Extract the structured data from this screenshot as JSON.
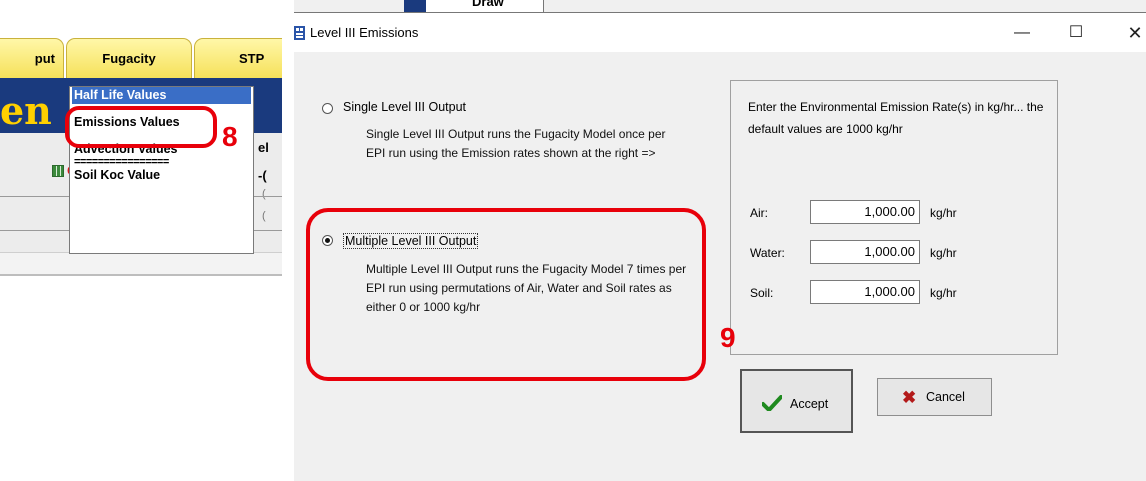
{
  "background_app": {
    "tabs": [
      "put",
      "Fugacity",
      "STP"
    ],
    "big_text": "en",
    "red_fragment": "Ca",
    "right_fragments": [
      "el",
      "-(",
      "(",
      "("
    ],
    "fugacity_menu": {
      "items": [
        "Half Life Values",
        "Emissions Values",
        "Advection Values",
        "Soil Koc Value"
      ],
      "separator": "================",
      "highlighted_index": 0
    }
  },
  "dialog": {
    "partial_tab_label": "Draw",
    "title": "Level III Emissions",
    "window_controls": {
      "minimize": "—",
      "maximize": "☐",
      "close": "✕"
    },
    "options": {
      "single": {
        "label": "Single Level III Output",
        "description": "Single Level III Output runs the Fugacity Model once per EPI run using the Emission rates shown at the right =>",
        "selected": false
      },
      "multiple": {
        "label": "Multiple Level III Output",
        "description": "Multiple Level III Output runs the Fugacity Model 7 times per EPI run using permutations of Air, Water and Soil rates as either 0 or 1000 kg/hr",
        "selected": true
      }
    },
    "emission_rates": {
      "intro": "Enter the Environmental Emission Rate(s) in kg/hr... the default values are 1000 kg/hr",
      "unit": "kg/hr",
      "air": {
        "label": "Air:",
        "value": "1,000.00"
      },
      "water": {
        "label": "Water:",
        "value": "1,000.00"
      },
      "soil": {
        "label": "Soil:",
        "value": "1,000.00"
      }
    },
    "buttons": {
      "accept": "Accept",
      "cancel": "Cancel"
    }
  },
  "annotations": {
    "step_8": "8",
    "step_9": "9"
  },
  "colors": {
    "annotation_red": "#e8000a",
    "menu_highlight": "#3a6ec6",
    "app_blue": "#1a3a7e",
    "tab_yellow": "#f6e15a"
  }
}
